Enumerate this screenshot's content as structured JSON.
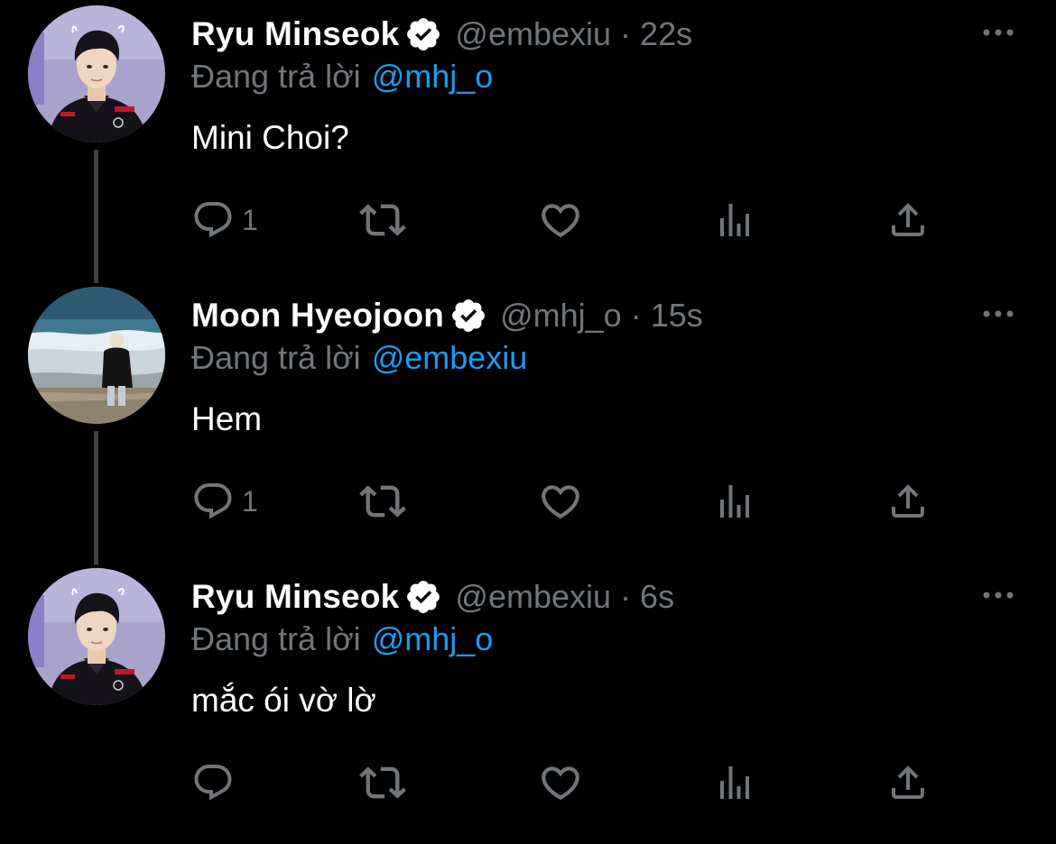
{
  "colors": {
    "background": "#000000",
    "name": "#ffffff",
    "secondary": "#71767b",
    "mention": "#1d9bf0",
    "thread_line": "#3c4044"
  },
  "replying_prefix": "Đang trả lời",
  "separator": "·",
  "tweets": [
    {
      "name": "Ryu Minseok",
      "handle": "@embexiu",
      "time": "22s",
      "reply_to": "@mhj_o",
      "text": "Mini Choi?",
      "reply_count": "1",
      "avatar_icon": "avatar-esports-player",
      "verified_icon": "verified-badge-icon"
    },
    {
      "name": "Moon Hyeojoon",
      "handle": "@mhj_o",
      "time": "15s",
      "reply_to": "@embexiu",
      "text": "Hem",
      "reply_count": "1",
      "avatar_icon": "avatar-beach",
      "verified_icon": "verified-badge-icon"
    },
    {
      "name": "Ryu Minseok",
      "handle": "@embexiu",
      "time": "6s",
      "reply_to": "@mhj_o",
      "text": "mắc ói vờ lờ",
      "reply_count": "",
      "avatar_icon": "avatar-esports-player",
      "verified_icon": "verified-badge-icon"
    }
  ]
}
